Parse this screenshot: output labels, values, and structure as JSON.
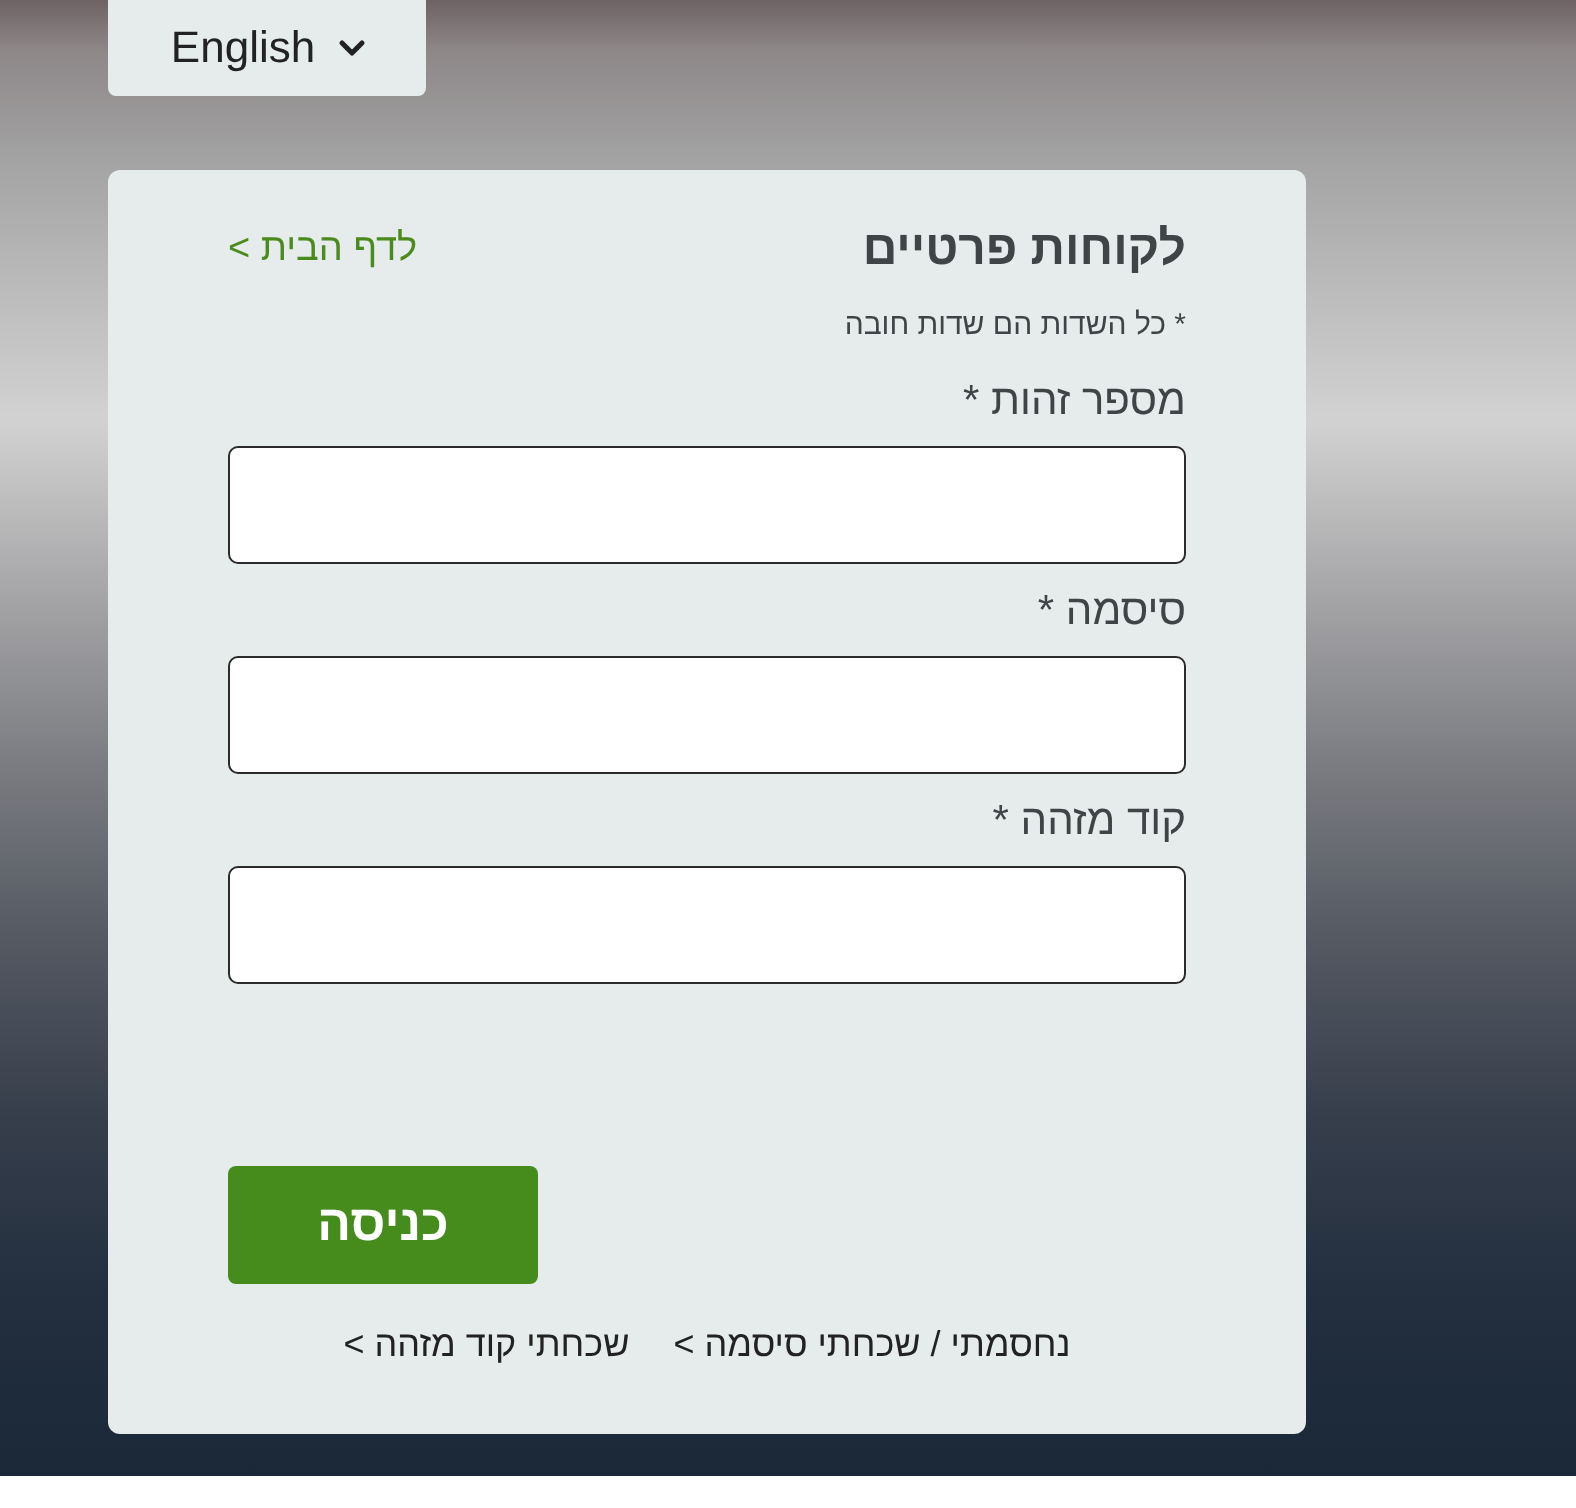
{
  "language_selector": {
    "label": "English"
  },
  "login_card": {
    "title": "לקוחות פרטיים",
    "home_link": "לדף הבית >",
    "required_note": "* כל השדות הם שדות חובה",
    "fields": [
      {
        "label": "מספר זהות *"
      },
      {
        "label": "סיסמה *"
      },
      {
        "label": "קוד מזהה *"
      }
    ],
    "submit_button": "כניסה",
    "help_links": [
      "נחסמתי / שכחתי סיסמה >",
      "שכחתי קוד מזהה >"
    ]
  }
}
